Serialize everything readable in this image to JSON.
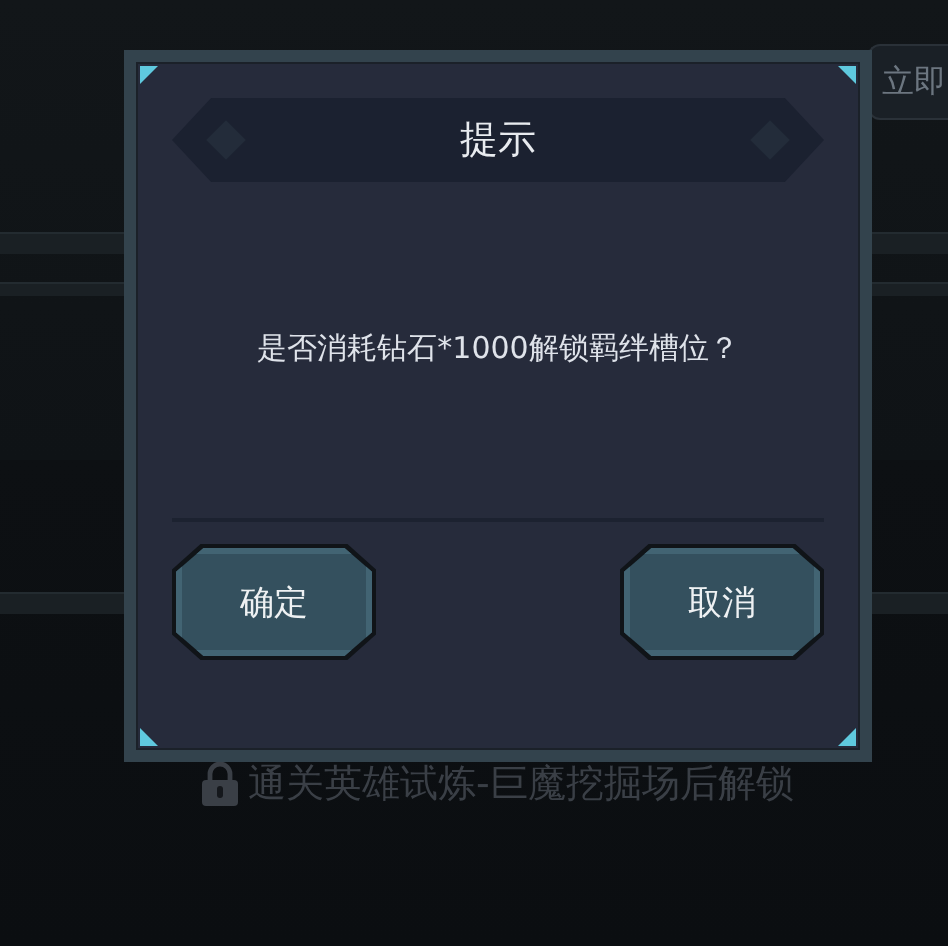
{
  "background": {
    "unlock_button": {
      "label": "立即"
    },
    "lock_hint": "通关英雄试炼-巨魔挖掘场后解锁"
  },
  "dialog": {
    "title": "提示",
    "message": "是否消耗钻石*1000解锁羁绊槽位？",
    "buttons": [
      {
        "label": "确定"
      },
      {
        "label": "取消"
      }
    ]
  }
}
